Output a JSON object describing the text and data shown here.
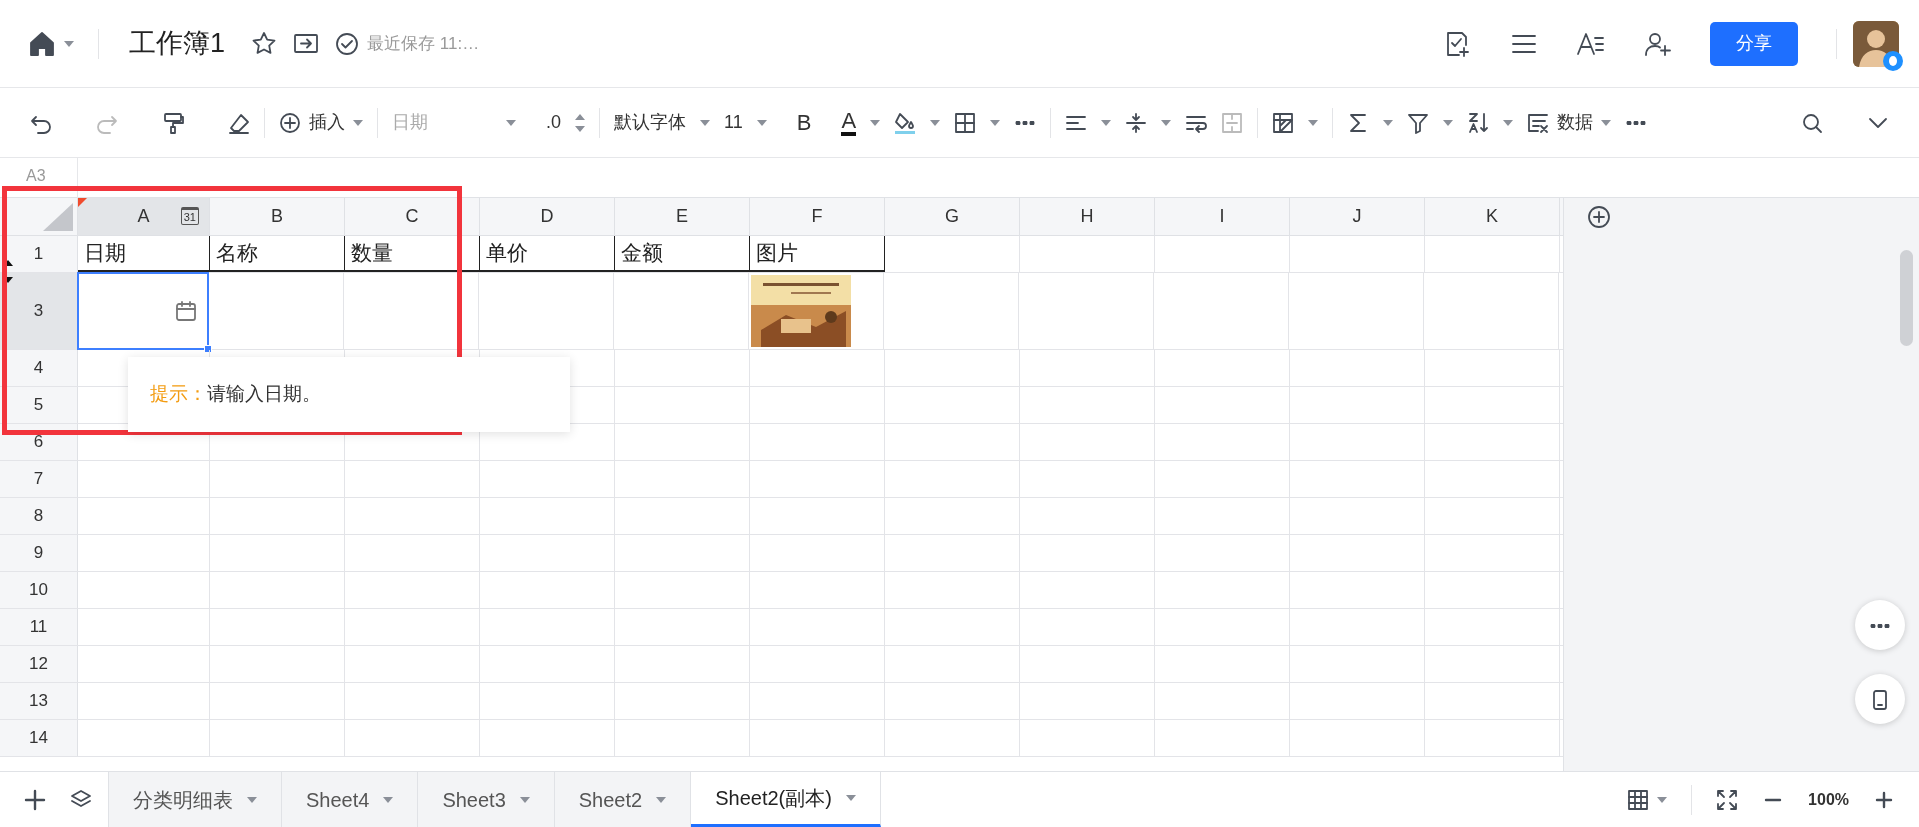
{
  "header": {
    "title": "工作簿1",
    "save_status": "最近保存 11:…",
    "share_label": "分享"
  },
  "toolbar": {
    "insert_label": "插入",
    "number_format": "日期",
    "decimal_label": ".0",
    "font_name": "默认字体",
    "font_size": "11",
    "bold_label": "B",
    "font_color_label": "A",
    "data_label": "数据"
  },
  "name_box": "A3",
  "columns": [
    {
      "label": "A",
      "selected": true,
      "badge": "31",
      "marker": true
    },
    {
      "label": "B",
      "selected": false
    },
    {
      "label": "C",
      "selected": false
    },
    {
      "label": "D",
      "selected": false
    },
    {
      "label": "E",
      "selected": false
    },
    {
      "label": "F",
      "selected": false
    },
    {
      "label": "G",
      "selected": false
    },
    {
      "label": "H",
      "selected": false
    },
    {
      "label": "I",
      "selected": false
    },
    {
      "label": "J",
      "selected": false
    },
    {
      "label": "K",
      "selected": false
    }
  ],
  "rows": [
    {
      "label": "1",
      "selected": false,
      "hidden_below": true,
      "cells": [
        {
          "kind": "header",
          "text": "日期"
        },
        {
          "kind": "header",
          "text": "名称"
        },
        {
          "kind": "header",
          "text": "数量"
        },
        {
          "kind": "header",
          "text": "单价"
        },
        {
          "kind": "header",
          "text": "金额"
        },
        {
          "kind": "header",
          "text": "图片"
        }
      ]
    },
    {
      "label": "3",
      "selected": true,
      "hidden_above": true,
      "cells": [
        {
          "kind": "date-input"
        },
        {
          "kind": "empty"
        },
        {
          "kind": "empty"
        },
        {
          "kind": "empty"
        },
        {
          "kind": "empty"
        },
        {
          "kind": "picture"
        }
      ]
    },
    {
      "label": "4",
      "selected": false
    },
    {
      "label": "5",
      "selected": false
    },
    {
      "label": "6",
      "selected": false
    },
    {
      "label": "7",
      "selected": false
    },
    {
      "label": "8",
      "selected": false
    },
    {
      "label": "9",
      "selected": false
    },
    {
      "label": "10",
      "selected": false
    },
    {
      "label": "11",
      "selected": false
    },
    {
      "label": "12",
      "selected": false
    },
    {
      "label": "13",
      "selected": false
    },
    {
      "label": "14",
      "selected": false
    }
  ],
  "hint": {
    "label": "提示：",
    "text": "请输入日期。"
  },
  "sheets": [
    {
      "label": "分类明细表",
      "selected": false
    },
    {
      "label": "Sheet4",
      "selected": false
    },
    {
      "label": "Sheet3",
      "selected": false
    },
    {
      "label": "Sheet2",
      "selected": false
    },
    {
      "label": "Sheet2(副本)",
      "selected": true
    }
  ],
  "zoom_level": "100%"
}
